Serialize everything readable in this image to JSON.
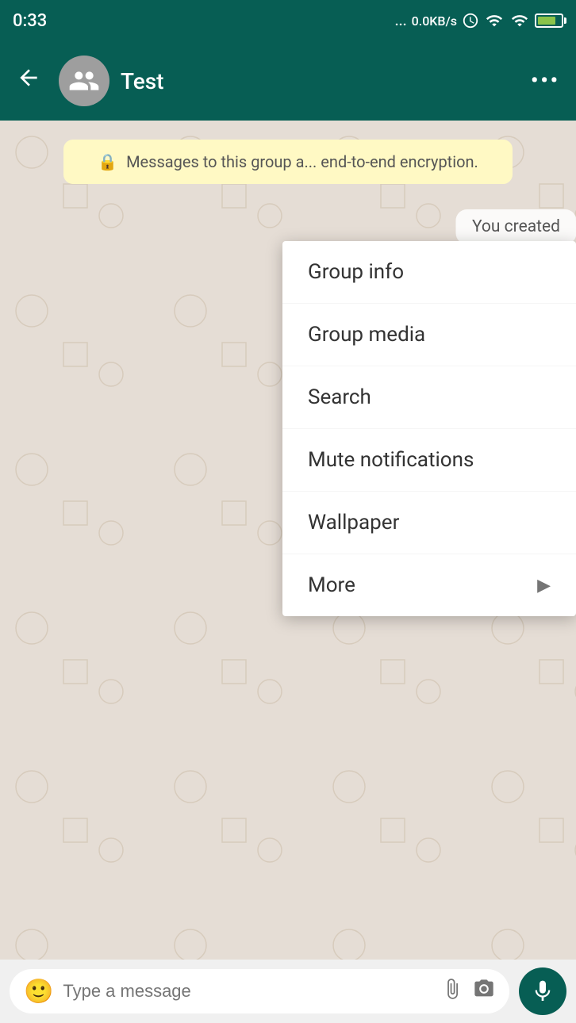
{
  "statusBar": {
    "time": "0:33",
    "network": "...",
    "speed": "0.0KB/s",
    "batteryLevel": 80
  },
  "toolbar": {
    "backLabel": "←",
    "chatName": "Test",
    "dotsLabel": "•••"
  },
  "chat": {
    "encryptionMsg": " Messages to this group a... end-to-end encryption.",
    "systemMsg": "You created"
  },
  "menu": {
    "items": [
      {
        "id": "group-info",
        "label": "Group info",
        "hasArrow": false
      },
      {
        "id": "group-media",
        "label": "Group media",
        "hasArrow": false
      },
      {
        "id": "search",
        "label": "Search",
        "hasArrow": false
      },
      {
        "id": "mute-notifications",
        "label": "Mute notifications",
        "hasArrow": false
      },
      {
        "id": "wallpaper",
        "label": "Wallpaper",
        "hasArrow": false
      },
      {
        "id": "more",
        "label": "More",
        "hasArrow": true
      }
    ]
  },
  "inputBar": {
    "placeholder": "Type a message"
  }
}
